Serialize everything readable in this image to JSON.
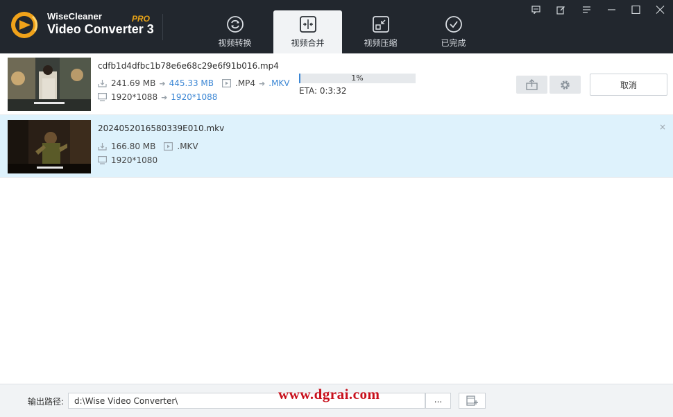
{
  "app": {
    "brand_top": "WiseCleaner",
    "brand_main": "Video Converter 3",
    "brand_pro": "PRO"
  },
  "tabs": [
    {
      "label": "视频转换",
      "icon": "convert-icon",
      "active": false
    },
    {
      "label": "视频合并",
      "icon": "merge-icon",
      "active": true
    },
    {
      "label": "视频压缩",
      "icon": "compress-icon",
      "active": false
    },
    {
      "label": "已完成",
      "icon": "check-icon",
      "active": false
    }
  ],
  "files": [
    {
      "name": "cdfb1d4dfbc1b78e6e68c29e6f91b016.mp4",
      "size_src": "241.69 MB",
      "size_dst": "445.33 MB",
      "format_src": ".MP4",
      "format_dst": ".MKV",
      "res_src": "1920*1088",
      "res_dst": "1920*1088",
      "progress_text": "1%",
      "progress": 0.01,
      "eta": "ETA: 0:3:32",
      "cancel_label": "取消"
    },
    {
      "name": "2024052016580339E010.mkv",
      "size": "166.80 MB",
      "format": ".MKV",
      "res": "1920*1080",
      "close": "×"
    }
  ],
  "footer": {
    "output_label": "输出路径:",
    "output_path": "d:\\Wise Video Converter\\",
    "browse_label": "...",
    "watermark": "www.dgrai.com"
  },
  "colors": {
    "header_bg": "#22272e",
    "accent": "#3b86d4",
    "selected_row": "#def2fc",
    "watermark": "#c8101c"
  }
}
